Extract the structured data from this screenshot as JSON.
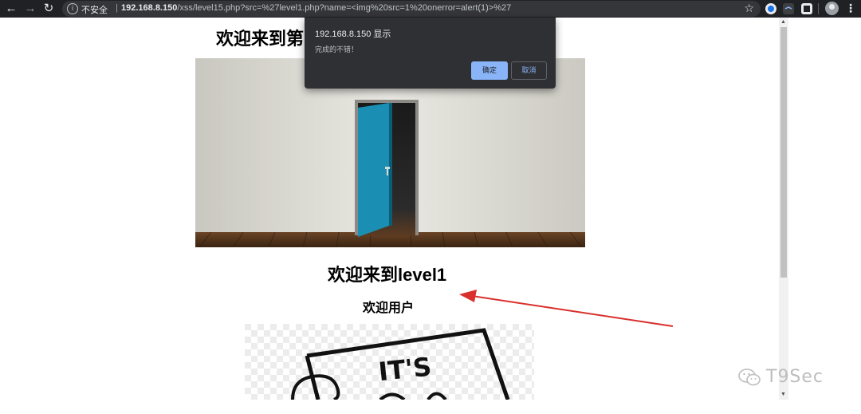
{
  "browser": {
    "back_icon": "arrow-left-icon",
    "forward_icon": "arrow-right-icon",
    "reload_icon": "reload-icon",
    "security_label": "不安全",
    "separator": "|",
    "url_host": "192.168.8.150",
    "url_path": "/xss/level15.php?src=%27level1.php?name=<img%20src=1%20onerror=alert(1)>%27",
    "bookmark_icon": "star-icon",
    "extensions": [
      "circle-extension-icon",
      "tab-extension-icon",
      "square-extension-icon"
    ],
    "profile_icon": "avatar-icon",
    "menu_icon": "more-vert-icon"
  },
  "page": {
    "top_heading": "欢迎来到第",
    "level_heading": "欢迎来到level1",
    "user_heading": "欢迎用户",
    "sign_text": "IT'S"
  },
  "dialog": {
    "title": "192.168.8.150 显示",
    "message": "完成的不错！",
    "ok_label": "确定",
    "cancel_label": "取消"
  },
  "watermark": {
    "text": "T9Sec",
    "icon": "wechat-icon"
  },
  "colors": {
    "browser_bar": "#202124",
    "dialog_bg": "#2f3034",
    "ok_button": "#8ab4f8",
    "annotation_arrow": "#d9302c",
    "door": "#1a8fb3"
  }
}
